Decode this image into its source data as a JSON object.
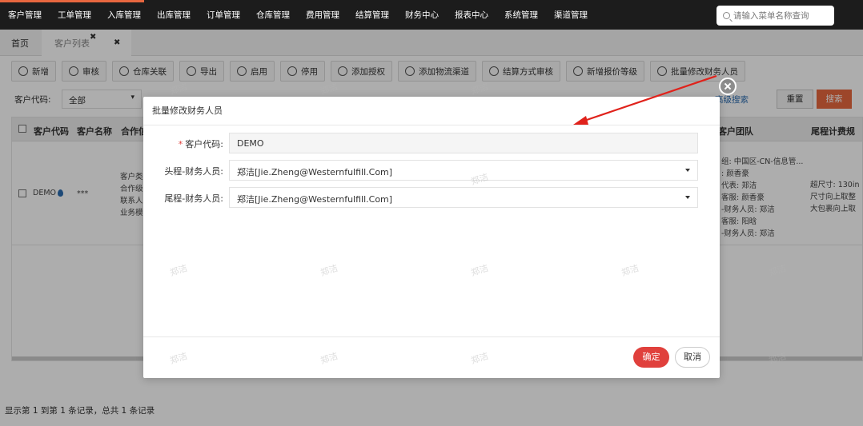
{
  "nav": {
    "items": [
      "客户管理",
      "工单管理",
      "入库管理",
      "出库管理",
      "订单管理",
      "仓库管理",
      "费用管理",
      "结算管理",
      "财务中心",
      "报表中心",
      "系统管理",
      "渠道管理"
    ],
    "search_placeholder": "请输入菜单名称查询",
    "accent_color": "#e8673f"
  },
  "tabs": {
    "home": "首页",
    "active": "客户列表",
    "close_symbol": "✖"
  },
  "toolbar": {
    "buttons": [
      "新增",
      "审核",
      "仓库关联",
      "导出",
      "启用",
      "停用",
      "添加授权",
      "添加物流渠道",
      "结算方式审核",
      "新增报价等级",
      "批量修改财务人员"
    ]
  },
  "filters": {
    "customer_code_label": "客户代码:",
    "customer_code_value": "全部",
    "advanced": "高级搜索",
    "reset": "重置",
    "search": "搜索"
  },
  "grid": {
    "headers": [
      "客户代码",
      "客户名称",
      "合作信",
      "客户团队",
      "尾程计费规"
    ],
    "row": {
      "code": "DEMO",
      "name": "***",
      "info_lines": [
        "客户类",
        "合作级",
        "联系人",
        "业务模"
      ],
      "team_lines": [
        "组: 中国区-CN-信息管...",
        ": 颜香豪",
        "代表: 郑洁",
        "客服: 颜香豪",
        "-财务人员: 郑洁",
        "客服: 阳晗",
        "-财务人员: 郑洁"
      ],
      "billing_lines": [
        "超尺寸: 130in",
        "尺寸向上取整",
        "大包裹向上取"
      ]
    }
  },
  "pager": {
    "text": "显示第 1 到第 1 条记录，总共 1 条记录"
  },
  "modal": {
    "title": "批量修改财务人员",
    "fields": {
      "customer_code": {
        "label": "客户代码:",
        "required_mark": "*",
        "value": "DEMO"
      },
      "head_finance": {
        "label": "头程-财务人员:",
        "value": "郑洁[Jie.Zheng@Westernfulfill.Com]"
      },
      "tail_finance": {
        "label": "尾程-财务人员:",
        "value": "郑洁[Jie.Zheng@Westernfulfill.Com]"
      }
    },
    "ok": "确定",
    "cancel": "取消",
    "ok_color": "#e0403c"
  },
  "watermark": "郑洁"
}
